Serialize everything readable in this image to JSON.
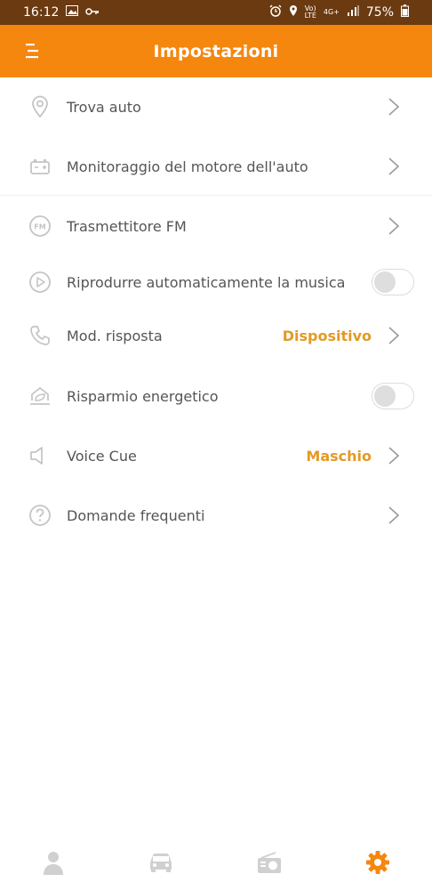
{
  "status_bar": {
    "time": "16:12",
    "battery": "75%",
    "net_top": "4G+",
    "volte_top": "Vo)",
    "volte_bottom": "LTE"
  },
  "header": {
    "title": "Impostazioni"
  },
  "settings": {
    "items": [
      {
        "label": "Trova auto",
        "icon": "location-pin-icon"
      },
      {
        "label": "Monitoraggio del motore dell'auto",
        "icon": "car-battery-icon"
      },
      {
        "label": "Trasmettitore FM",
        "icon": "fm-icon"
      },
      {
        "label": "Riprodurre automaticamente la musica",
        "icon": "play-circle-icon",
        "toggle": false
      },
      {
        "label": "Mod. risposta",
        "icon": "phone-icon",
        "value": "Dispositivo"
      },
      {
        "label": "Risparmio energetico",
        "icon": "energy-saving-icon",
        "toggle": false
      },
      {
        "label": "Voice Cue",
        "icon": "speaker-icon",
        "value": "Maschio"
      },
      {
        "label": "Domande frequenti",
        "icon": "question-circle-icon"
      }
    ]
  },
  "bottom_nav": {
    "items": [
      {
        "icon": "person-icon",
        "active": false
      },
      {
        "icon": "car-icon",
        "active": false
      },
      {
        "icon": "radio-icon",
        "active": false
      },
      {
        "icon": "gear-icon",
        "active": true
      }
    ]
  },
  "colors": {
    "accent": "#f5870f",
    "value_text": "#e39a22",
    "status_bar": "#6b3a10",
    "icon_gray": "#c4c4c4"
  }
}
